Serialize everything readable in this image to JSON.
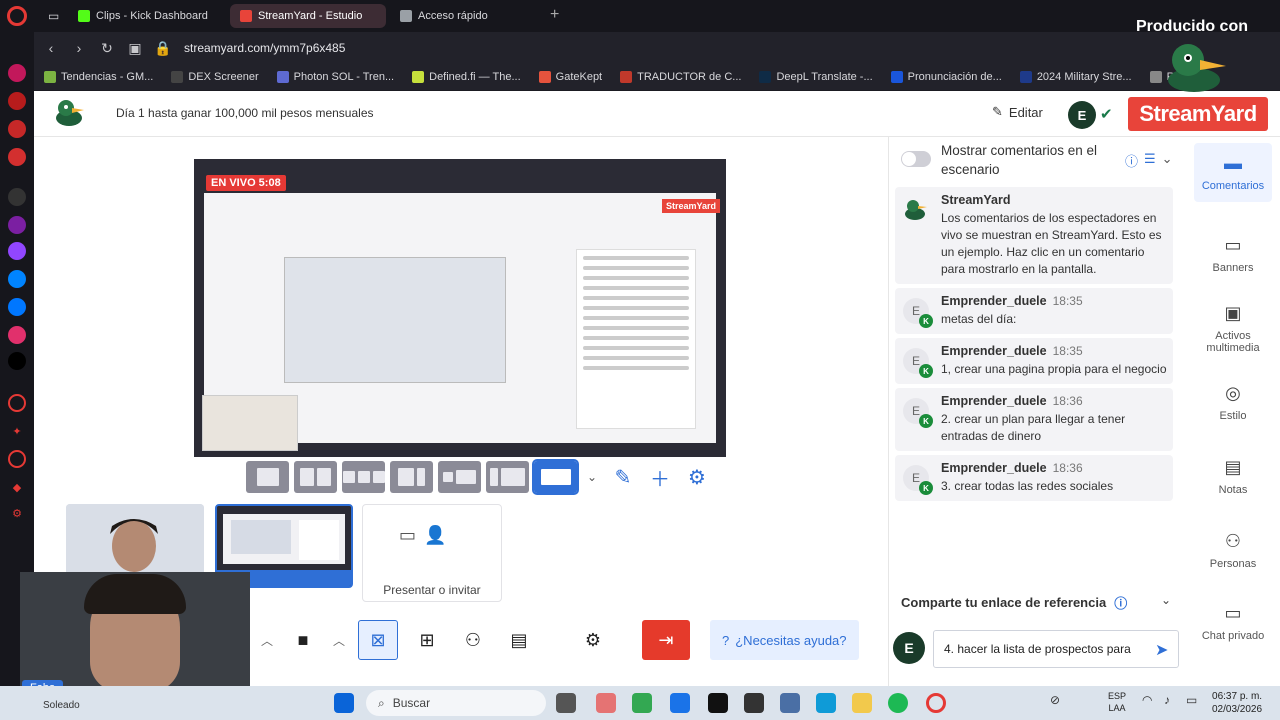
{
  "browser": {
    "tabs": [
      {
        "label": "Clips - Kick Dashboard",
        "color": "#53fc18"
      },
      {
        "label": "StreamYard - Estudio",
        "color": "#e8443a"
      },
      {
        "label": "Acceso rápido",
        "color": "#9aa0a6"
      }
    ],
    "url": "streamyard.com/ymm7p6x485",
    "bookmarks": [
      {
        "label": "Tendencias - GM...",
        "color": "#7cb342"
      },
      {
        "label": "DEX Screener",
        "color": "#222"
      },
      {
        "label": "Photon SOL - Tren...",
        "color": "#5e6ad2"
      },
      {
        "label": "Defined.fi — The...",
        "color": "#c6e03c"
      },
      {
        "label": "GateKept",
        "color": "#e5533d"
      },
      {
        "label": "TRADUCTOR de C...",
        "color": "#c0392b"
      },
      {
        "label": "DeepL Translate -...",
        "color": "#0f2b46"
      },
      {
        "label": "Pronunciación de...",
        "color": "#1a56db"
      },
      {
        "label": "2024 Military Stre...",
        "color": "#1e3a8a"
      },
      {
        "label": "Rueda",
        "color": "#888"
      }
    ],
    "watermark": "Producido con"
  },
  "header": {
    "title": "Día 1 hasta ganar 100,000 mil pesos mensuales",
    "edit_label": "Editar",
    "avatar_letter": "E",
    "brand": "StreamYard"
  },
  "stage": {
    "live_badge": "EN VIVO 5:08"
  },
  "sources": {
    "present_label": "Presentar o invitar",
    "screen_tag": "bo"
  },
  "controls": {
    "help_label": "¿Necesitas ayuda?"
  },
  "comments": {
    "toggle_label": "Mostrar comentarios en el escenario",
    "items": [
      {
        "author": "StreamYard",
        "time": "",
        "text": "Los comentarios de los espectadores en vivo se muestran en StreamYard. Esto es un ejemplo. Haz clic en un comentario para mostrarlo en la pantalla."
      },
      {
        "author": "Emprender_duele",
        "time": "18:35",
        "text": "metas del día:"
      },
      {
        "author": "Emprender_duele",
        "time": "18:35",
        "text": "1, crear una pagina propia para el negocio"
      },
      {
        "author": "Emprender_duele",
        "time": "18:36",
        "text": "2. crear un plan para llegar a tener entradas de dinero"
      },
      {
        "author": "Emprender_duele",
        "time": "18:36",
        "text": "3. crear todas las redes sociales"
      }
    ],
    "referral_label": "Comparte tu enlace de referencia",
    "input_value": "4. hacer la lista de prospectos para",
    "avatar_letter": "E"
  },
  "rail": [
    {
      "label": "Comentarios",
      "icon": "comment-icon"
    },
    {
      "label": "Banners",
      "icon": "banner-icon"
    },
    {
      "label": "Activos multimedia",
      "icon": "media-icon"
    },
    {
      "label": "Estilo",
      "icon": "palette-icon"
    },
    {
      "label": "Notas",
      "icon": "notes-icon"
    },
    {
      "label": "Personas",
      "icon": "people-icon"
    },
    {
      "label": "Chat privado",
      "icon": "chat-icon"
    }
  ],
  "selfcam": {
    "name": "Fabo"
  },
  "taskbar": {
    "weather": "Soleado",
    "search_placeholder": "Buscar",
    "lang_1": "ESP",
    "lang_2": "LAA",
    "time": "06:37 p. m.",
    "date": "02/03/2026"
  },
  "colors": {
    "brand_red": "#e8443a",
    "accent_blue": "#2f6fd6"
  }
}
